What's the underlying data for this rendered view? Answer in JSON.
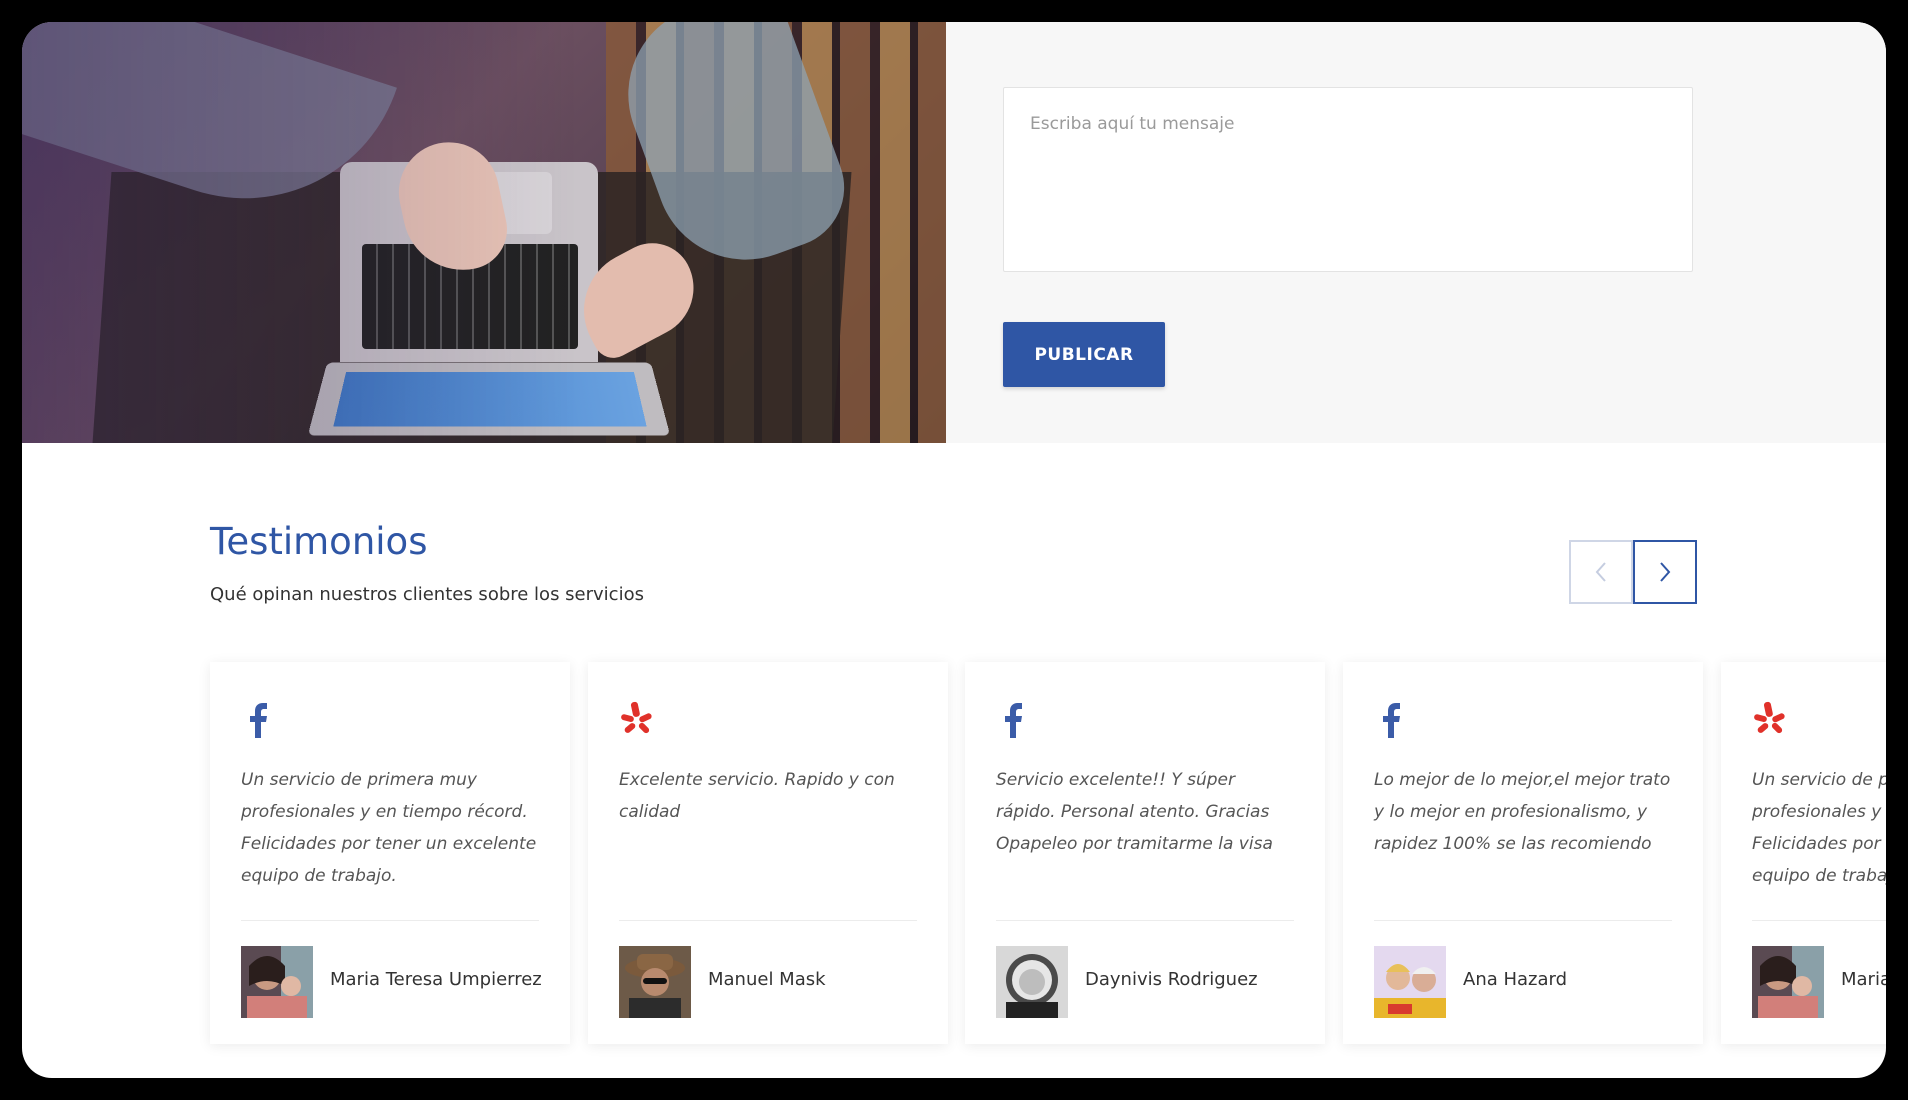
{
  "contact_form": {
    "message_placeholder": "Escriba aquí tu mensaje",
    "submit_label": "PUBLICAR"
  },
  "testimonials": {
    "title": "Testimonios",
    "subtitle": "Qué opinan nuestros clientes sobre los servicios",
    "prev_icon": "chevron-left-icon",
    "next_icon": "chevron-right-icon",
    "items": [
      {
        "source": "facebook",
        "quote": "Un servicio de primera muy profesionales y en tiempo récord. Felicidades por tener un excelente equipo de trabajo.",
        "author": "Maria Teresa Umpierrez"
      },
      {
        "source": "yelp",
        "quote": "Excelente servicio. Rapido y con calidad",
        "author": "Manuel Mask"
      },
      {
        "source": "facebook",
        "quote": "Servicio excelente!! Y súper rápido. Personal atento. Gracias Opapeleo por tramitarme la visa",
        "author": "Daynivis Rodriguez"
      },
      {
        "source": "facebook",
        "quote": "Lo mejor de lo mejor,el mejor trato y lo mejor en profesionalismo, y rapidez 100% se las recomiendo",
        "author": "Ana Hazard"
      },
      {
        "source": "yelp",
        "quote": "Un servicio de primera muy profesionales y en tiempo récord. Felicidades por tener un excelente equipo de trabajo.",
        "author": "Maria Teresa Umpierrez"
      }
    ]
  },
  "colors": {
    "brand_blue": "#2f56a5",
    "facebook_blue": "#3b5ca8",
    "yelp_red": "#e0312a",
    "form_background": "#f7f7f7"
  }
}
